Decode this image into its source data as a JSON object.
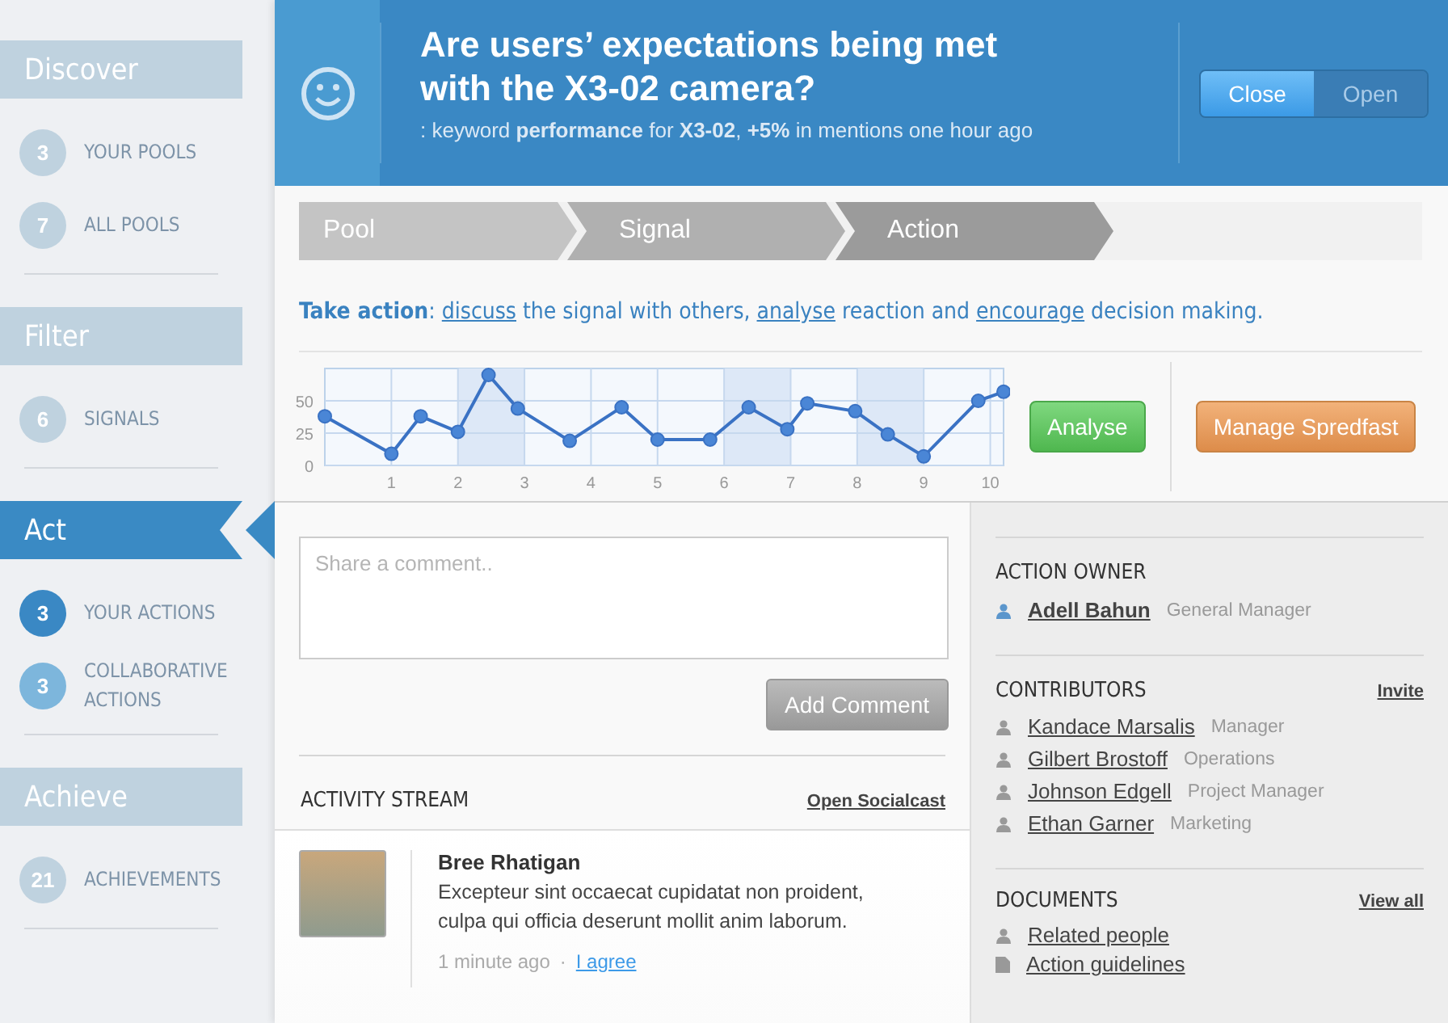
{
  "sidebar": {
    "sections": [
      {
        "title": "Discover",
        "selected": false,
        "items": [
          {
            "count": "3",
            "label": "YOUR POOLS",
            "selected": false
          },
          {
            "count": "7",
            "label": "ALL POOLS",
            "selected": false
          }
        ]
      },
      {
        "title": "Filter",
        "selected": false,
        "items": [
          {
            "count": "6",
            "label": "SIGNALS",
            "selected": false
          }
        ]
      },
      {
        "title": "Act",
        "selected": true,
        "items": [
          {
            "count": "3",
            "label": "YOUR ACTIONS",
            "selected": true
          },
          {
            "count": "3",
            "label": "COLLABORATIVE ACTIONS",
            "selected": false
          }
        ]
      },
      {
        "title": "Achieve",
        "selected": false,
        "items": [
          {
            "count": "21",
            "label": "ACHIEVEMENTS",
            "selected": false
          }
        ]
      }
    ]
  },
  "header": {
    "title": "Are users’ expectations being met with the X3-02 camera?",
    "subtitle": ": keyword **performance** for **X3-02**, **+5%** in mentions one hour ago",
    "toggle": [
      {
        "label": "Close",
        "selected": true
      },
      {
        "label": "Open",
        "selected": false
      }
    ]
  },
  "steps": [
    {
      "label": "Pool",
      "selected": false
    },
    {
      "label": "Signal",
      "selected": false
    },
    {
      "label": "Action",
      "selected": true
    }
  ],
  "take_action": {
    "label": "Take action",
    "parts": [
      {
        "text": ": ",
        "kind": "text"
      },
      {
        "text": "discuss",
        "kind": "link"
      },
      {
        "text": " the signal with others, ",
        "kind": "text"
      },
      {
        "text": "analyse",
        "kind": "link"
      },
      {
        "text": " reaction and ",
        "kind": "text"
      },
      {
        "text": "encourage",
        "kind": "link"
      },
      {
        "text": " decision making.",
        "kind": "text"
      }
    ]
  },
  "chart_data": {
    "type": "line",
    "x": [
      0,
      1,
      1.44,
      2,
      2.46,
      2.9,
      3.68,
      4.46,
      5,
      5.79,
      6.37,
      6.95,
      7.25,
      7.97,
      8.46,
      9,
      9.82,
      10.2
    ],
    "grid": true,
    "series": [
      {
        "color": "#3a72c4",
        "marker": "circle",
        "values": [
          38,
          9,
          38,
          26,
          70,
          44,
          19,
          45,
          20,
          20,
          45,
          28,
          48,
          42,
          24,
          7,
          50,
          57
        ]
      }
    ],
    "xlim": [
      0,
      10.2
    ],
    "ylim": [
      0,
      75
    ],
    "xticks": [
      1,
      2,
      3,
      4,
      5,
      6,
      7,
      8,
      9,
      10
    ],
    "yticks": [
      0,
      25,
      50
    ]
  },
  "actions": [
    {
      "label": "Analyse",
      "kind": "green"
    },
    {
      "label": "Manage Spredfast",
      "kind": "orange"
    }
  ],
  "comment": {
    "placeholder": "Share a comment..",
    "button": "Add Comment"
  },
  "activity": {
    "title": "ACTIVITY STREAM",
    "link": "Open Socialcast",
    "posts": [
      {
        "author": "Bree Rhatigan",
        "text": "Excepteur sint occaecat cupidatat non proident, culpa qui officia deserunt mollit anim laborum.",
        "time": "1 minute ago",
        "separator": "·",
        "action": "I agree"
      }
    ]
  },
  "owner": {
    "title": "ACTION OWNER",
    "people": [
      {
        "name": "Adell Bahun",
        "role": "General Manager"
      }
    ]
  },
  "contributors": {
    "title": "CONTRIBUTORS",
    "link": "Invite",
    "people": [
      {
        "name": "Kandace Marsalis",
        "role": "Manager"
      },
      {
        "name": "Gilbert Brostoff",
        "role": "Operations"
      },
      {
        "name": "Johnson Edgell",
        "role": "Project Manager"
      },
      {
        "name": "Ethan Garner",
        "role": "Marketing"
      }
    ]
  },
  "documents": {
    "title": "DOCUMENTS",
    "link": "View all",
    "items": [
      {
        "label": "Related people",
        "kind": "person"
      },
      {
        "label": "Action guidelines",
        "kind": "document"
      }
    ]
  }
}
